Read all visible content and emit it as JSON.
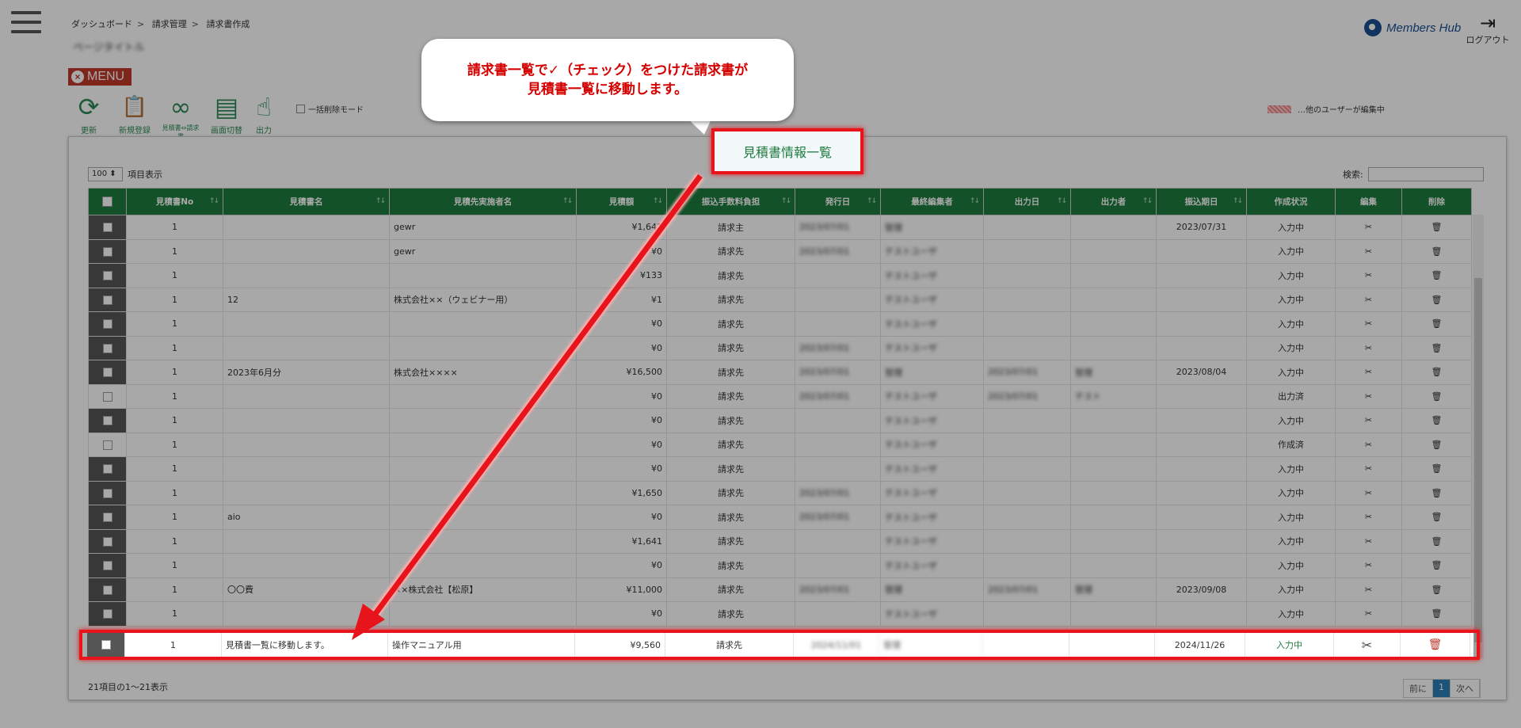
{
  "breadcrumb": [
    "ダッシュボード",
    "請求管理",
    "請求書作成"
  ],
  "page_title": "ページタイトル",
  "brand": "Members Hub",
  "logout_label": "ログアウト",
  "menu_label": "MENU",
  "toolbar": [
    {
      "label": "更新",
      "icon": "refresh-icon",
      "glyph": "⟳"
    },
    {
      "label": "新規登録",
      "icon": "clipboard-icon",
      "glyph": "📋"
    },
    {
      "label": "見積書⇔請求書",
      "icon": "swap-icon",
      "glyph": "∞"
    },
    {
      "label": "画面切替",
      "icon": "screen-icon",
      "glyph": "▤"
    },
    {
      "label": "出力",
      "icon": "pointer-icon",
      "glyph": "☝"
    }
  ],
  "bulk_delete_label": "一括削除モード",
  "editing_legend": "…他のユーザーが編集中",
  "per_page": {
    "value": "100 ⬍",
    "label": "項目表示"
  },
  "search_label": "検索:",
  "columns": [
    "見積書No",
    "見積書名",
    "見積先実施者名",
    "見積額",
    "振込手数料負担",
    "発行日",
    "最終編集者",
    "出力日",
    "出力者",
    "振込期日",
    "作成状況",
    "編集",
    "削除"
  ],
  "rows": [
    {
      "no": "1",
      "name": "",
      "client": "gewr",
      "amount": "¥1,641",
      "fee": "請求主",
      "issued": "2023/07/01",
      "editor": "管理",
      "out_date": "",
      "out_user": "",
      "due": "2023/07/31",
      "status": "入力中",
      "checked": true
    },
    {
      "no": "1",
      "name": "",
      "client": "gewr",
      "amount": "¥0",
      "fee": "請求先",
      "issued": "2023/07/01",
      "editor": "テストユーザ",
      "out_date": "",
      "out_user": "",
      "due": "",
      "status": "入力中",
      "checked": true
    },
    {
      "no": "1",
      "name": "",
      "client": "",
      "amount": "¥133",
      "fee": "請求先",
      "issued": "",
      "editor": "テストユーザ",
      "out_date": "",
      "out_user": "",
      "due": "",
      "status": "入力中",
      "checked": true
    },
    {
      "no": "1",
      "name": "12",
      "client": "株式会社××（ウェビナー用）",
      "amount": "¥1",
      "fee": "請求先",
      "issued": "",
      "editor": "テストユーザ",
      "out_date": "",
      "out_user": "",
      "due": "",
      "status": "入力中",
      "checked": true
    },
    {
      "no": "1",
      "name": "",
      "client": "",
      "amount": "¥0",
      "fee": "請求先",
      "issued": "",
      "editor": "テストユーザ",
      "out_date": "",
      "out_user": "",
      "due": "",
      "status": "入力中",
      "checked": true
    },
    {
      "no": "1",
      "name": "",
      "client": "",
      "amount": "¥0",
      "fee": "請求先",
      "issued": "2023/07/01",
      "editor": "テストユーザ",
      "out_date": "",
      "out_user": "",
      "due": "",
      "status": "入力中",
      "checked": true
    },
    {
      "no": "1",
      "name": "2023年6月分",
      "client": "株式会社××××",
      "amount": "¥16,500",
      "fee": "請求先",
      "issued": "2023/07/01",
      "editor": "管理",
      "out_date": "2023/07/01",
      "out_user": "管理",
      "due": "2023/08/04",
      "status": "入力中",
      "checked": true
    },
    {
      "no": "1",
      "name": "",
      "client": "",
      "amount": "¥0",
      "fee": "請求先",
      "issued": "2023/07/01",
      "editor": "テストユーザ",
      "out_date": "2023/07/01",
      "out_user": "テスト",
      "due": "",
      "status": "出力済",
      "checked": false
    },
    {
      "no": "1",
      "name": "",
      "client": "",
      "amount": "¥0",
      "fee": "請求先",
      "issued": "",
      "editor": "テストユーザ",
      "out_date": "",
      "out_user": "",
      "due": "",
      "status": "入力中",
      "checked": true
    },
    {
      "no": "1",
      "name": "",
      "client": "",
      "amount": "¥0",
      "fee": "請求先",
      "issued": "",
      "editor": "テストユーザ",
      "out_date": "",
      "out_user": "",
      "due": "",
      "status": "作成済",
      "checked": false
    },
    {
      "no": "1",
      "name": "",
      "client": "",
      "amount": "¥0",
      "fee": "請求先",
      "issued": "",
      "editor": "テストユーザ",
      "out_date": "",
      "out_user": "",
      "due": "",
      "status": "入力中",
      "checked": true
    },
    {
      "no": "1",
      "name": "",
      "client": "",
      "amount": "¥1,650",
      "fee": "請求先",
      "issued": "2023/07/01",
      "editor": "テストユーザ",
      "out_date": "",
      "out_user": "",
      "due": "",
      "status": "入力中",
      "checked": true
    },
    {
      "no": "1",
      "name": "aio",
      "client": "",
      "amount": "¥0",
      "fee": "請求先",
      "issued": "2023/07/01",
      "editor": "テストユーザ",
      "out_date": "",
      "out_user": "",
      "due": "",
      "status": "入力中",
      "checked": true
    },
    {
      "no": "1",
      "name": "",
      "client": "",
      "amount": "¥1,641",
      "fee": "請求先",
      "issued": "",
      "editor": "テストユーザ",
      "out_date": "",
      "out_user": "",
      "due": "",
      "status": "入力中",
      "checked": true
    },
    {
      "no": "1",
      "name": "",
      "client": "",
      "amount": "¥0",
      "fee": "請求先",
      "issued": "",
      "editor": "テストユーザ",
      "out_date": "",
      "out_user": "",
      "due": "",
      "status": "入力中",
      "checked": true
    },
    {
      "no": "1",
      "name": "〇〇費",
      "client": "××株式会社【松原】",
      "amount": "¥11,000",
      "fee": "請求先",
      "issued": "2023/07/01",
      "editor": "管理",
      "out_date": "2023/07/01",
      "out_user": "管理",
      "due": "2023/09/08",
      "status": "入力中",
      "checked": true
    },
    {
      "no": "1",
      "name": "",
      "client": "",
      "amount": "¥0",
      "fee": "請求先",
      "issued": "",
      "editor": "テストユーザ",
      "out_date": "",
      "out_user": "",
      "due": "",
      "status": "入力中",
      "checked": true
    }
  ],
  "highlight_row": {
    "no": "1",
    "name": "見積書一覧に移動します。",
    "client": "操作マニュアル用",
    "amount": "¥9,560",
    "fee": "請求先",
    "issued": "2024/11/01",
    "editor": "管理",
    "due": "2024/11/26",
    "status": "入力中"
  },
  "footer_count": "21項目の1～21表示",
  "pager": {
    "prev": "前に",
    "current": "1",
    "next": "次へ"
  },
  "callout": {
    "line1": "請求書一覧で✓（チェック）をつけた請求書が",
    "line2": "見積書一覧に移動します。",
    "tab_label": "見積書情報一覧"
  },
  "colors": {
    "header_green": "#1e7b3d",
    "alert_red": "#e8141c",
    "callout_text": "#d40000"
  }
}
